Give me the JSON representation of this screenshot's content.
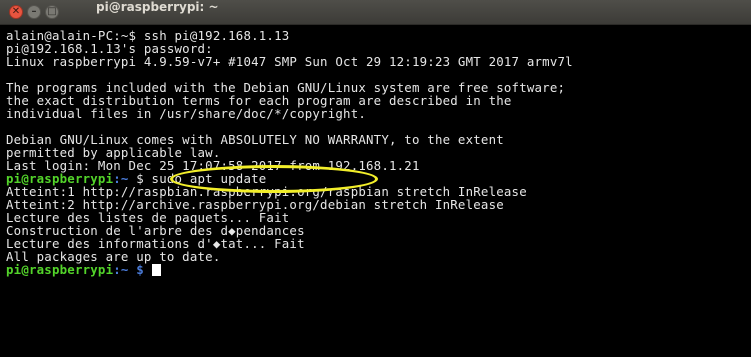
{
  "window": {
    "title": "pi@raspberrypi: ~",
    "controls": {
      "close_glyph": "✕",
      "min_glyph": "–",
      "max_glyph": "□"
    }
  },
  "terminal": {
    "lines": [
      "alain@alain-PC:~$ ssh pi@192.168.1.13",
      "pi@192.168.1.13's password:",
      "Linux raspberrypi 4.9.59-v7+ #1047 SMP Sun Oct 29 12:19:23 GMT 2017 armv7l",
      "",
      "The programs included with the Debian GNU/Linux system are free software;",
      "the exact distribution terms for each program are described in the",
      "individual files in /usr/share/doc/*/copyright.",
      "",
      "Debian GNU/Linux comes with ABSOLUTELY NO WARRANTY, to the extent",
      "permitted by applicable law.",
      "Last login: Mon Dec 25 17:07:58 2017 from 192.168.1.21",
      {
        "prompt_user": "pi@raspberrypi",
        "prompt_path": ":~ ",
        "command": "$ sudo apt update"
      },
      "Atteint:1 http://raspbian.raspberrypi.org/raspbian stretch InRelease",
      "Atteint:2 http://archive.raspberrypi.org/debian stretch InRelease",
      "Lecture des listes de paquets... Fait",
      "Construction de l'arbre des d◆pendances",
      "Lecture des informations d'◆tat... Fait",
      "All packages are up to date.",
      {
        "prompt_user": "pi@raspberrypi",
        "prompt_path": ":~ $ ",
        "command": ""
      }
    ]
  },
  "annotation": {
    "color": "#f2ee2a"
  }
}
